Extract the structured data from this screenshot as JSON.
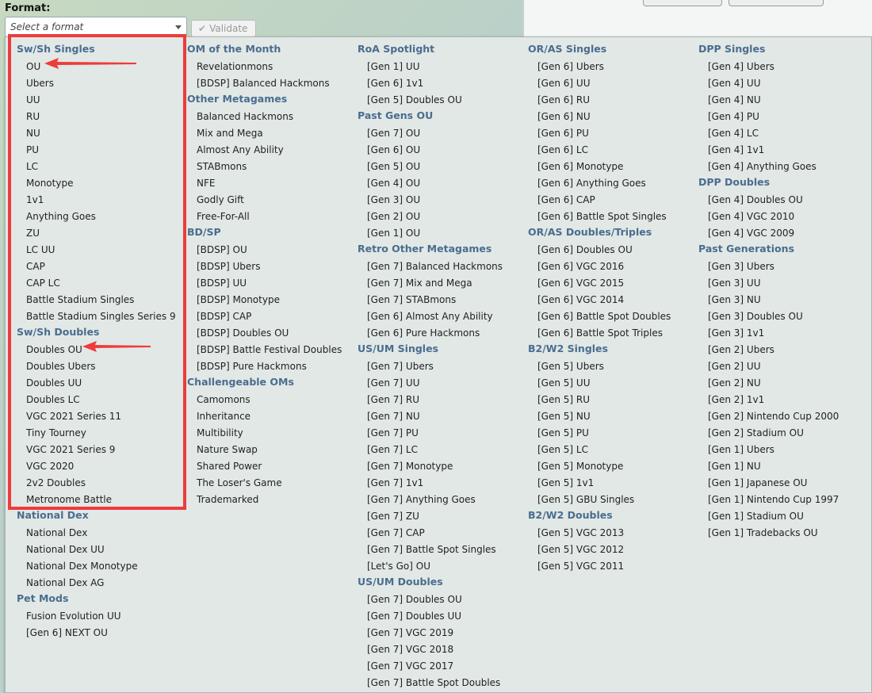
{
  "format_label": "Format:",
  "select_placeholder": "Select a format",
  "validate_label": "Validate",
  "columns": [
    {
      "sections": [
        {
          "title": "Sw/Sh Singles",
          "items": [
            "OU",
            "Ubers",
            "UU",
            "RU",
            "NU",
            "PU",
            "LC",
            "Monotype",
            "1v1",
            "Anything Goes",
            "ZU",
            "LC UU",
            "CAP",
            "CAP LC",
            "Battle Stadium Singles",
            "Battle Stadium Singles Series 9"
          ]
        },
        {
          "title": "Sw/Sh Doubles",
          "items": [
            "Doubles OU",
            "Doubles Ubers",
            "Doubles UU",
            "Doubles LC",
            "VGC 2021 Series 11",
            "Tiny Tourney",
            "VGC 2021 Series 9",
            "VGC 2020",
            "2v2 Doubles",
            "Metronome Battle"
          ]
        },
        {
          "title": "National Dex",
          "items": [
            "National Dex",
            "National Dex UU",
            "National Dex Monotype",
            "National Dex AG"
          ]
        },
        {
          "title": "Pet Mods",
          "items": [
            "Fusion Evolution UU",
            "[Gen 6] NEXT OU"
          ]
        }
      ]
    },
    {
      "sections": [
        {
          "title": "OM of the Month",
          "items": [
            "Revelationmons",
            "[BDSP] Balanced Hackmons"
          ]
        },
        {
          "title": "Other Metagames",
          "items": [
            "Balanced Hackmons",
            "Mix and Mega",
            "Almost Any Ability",
            "STABmons",
            "NFE",
            "Godly Gift",
            "Free-For-All"
          ]
        },
        {
          "title": "BD/SP",
          "items": [
            "[BDSP] OU",
            "[BDSP] Ubers",
            "[BDSP] UU",
            "[BDSP] Monotype",
            "[BDSP] CAP",
            "[BDSP] Doubles OU",
            "[BDSP] Battle Festival Doubles",
            "[BDSP] Pure Hackmons"
          ]
        },
        {
          "title": "Challengeable OMs",
          "items": [
            "Camomons",
            "Inheritance",
            "Multibility",
            "Nature Swap",
            "Shared Power",
            "The Loser's Game",
            "Trademarked"
          ]
        }
      ]
    },
    {
      "sections": [
        {
          "title": "RoA Spotlight",
          "items": [
            "[Gen 1] UU",
            "[Gen 6] 1v1",
            "[Gen 5] Doubles OU"
          ]
        },
        {
          "title": "Past Gens OU",
          "items": [
            "[Gen 7] OU",
            "[Gen 6] OU",
            "[Gen 5] OU",
            "[Gen 4] OU",
            "[Gen 3] OU",
            "[Gen 2] OU",
            "[Gen 1] OU"
          ]
        },
        {
          "title": "Retro Other Metagames",
          "items": [
            "[Gen 7] Balanced Hackmons",
            "[Gen 7] Mix and Mega",
            "[Gen 7] STABmons",
            "[Gen 6] Almost Any Ability",
            "[Gen 6] Pure Hackmons"
          ]
        },
        {
          "title": "US/UM Singles",
          "items": [
            "[Gen 7] Ubers",
            "[Gen 7] UU",
            "[Gen 7] RU",
            "[Gen 7] NU",
            "[Gen 7] PU",
            "[Gen 7] LC",
            "[Gen 7] Monotype",
            "[Gen 7] 1v1",
            "[Gen 7] Anything Goes",
            "[Gen 7] ZU",
            "[Gen 7] CAP",
            "[Gen 7] Battle Spot Singles",
            "[Let's Go] OU"
          ]
        },
        {
          "title": "US/UM Doubles",
          "items": [
            "[Gen 7] Doubles OU",
            "[Gen 7] Doubles UU",
            "[Gen 7] VGC 2019",
            "[Gen 7] VGC 2018",
            "[Gen 7] VGC 2017",
            "[Gen 7] Battle Spot Doubles"
          ]
        }
      ]
    },
    {
      "sections": [
        {
          "title": "OR/AS Singles",
          "items": [
            "[Gen 6] Ubers",
            "[Gen 6] UU",
            "[Gen 6] RU",
            "[Gen 6] NU",
            "[Gen 6] PU",
            "[Gen 6] LC",
            "[Gen 6] Monotype",
            "[Gen 6] Anything Goes",
            "[Gen 6] CAP",
            "[Gen 6] Battle Spot Singles"
          ]
        },
        {
          "title": "OR/AS Doubles/Triples",
          "items": [
            "[Gen 6] Doubles OU",
            "[Gen 6] VGC 2016",
            "[Gen 6] VGC 2015",
            "[Gen 6] VGC 2014",
            "[Gen 6] Battle Spot Doubles",
            "[Gen 6] Battle Spot Triples"
          ]
        },
        {
          "title": "B2/W2 Singles",
          "items": [
            "[Gen 5] Ubers",
            "[Gen 5] UU",
            "[Gen 5] RU",
            "[Gen 5] NU",
            "[Gen 5] PU",
            "[Gen 5] LC",
            "[Gen 5] Monotype",
            "[Gen 5] 1v1",
            "[Gen 5] GBU Singles"
          ]
        },
        {
          "title": "B2/W2 Doubles",
          "items": [
            "[Gen 5] VGC 2013",
            "[Gen 5] VGC 2012",
            "[Gen 5] VGC 2011"
          ]
        }
      ]
    },
    {
      "sections": [
        {
          "title": "DPP Singles",
          "items": [
            "[Gen 4] Ubers",
            "[Gen 4] UU",
            "[Gen 4] NU",
            "[Gen 4] PU",
            "[Gen 4] LC",
            "[Gen 4] 1v1",
            "[Gen 4] Anything Goes"
          ]
        },
        {
          "title": "DPP Doubles",
          "items": [
            "[Gen 4] Doubles OU",
            "[Gen 4] VGC 2010",
            "[Gen 4] VGC 2009"
          ]
        },
        {
          "title": "Past Generations",
          "items": [
            "[Gen 3] Ubers",
            "[Gen 3] UU",
            "[Gen 3] NU",
            "[Gen 3] Doubles OU",
            "[Gen 3] 1v1",
            "[Gen 2] Ubers",
            "[Gen 2] UU",
            "[Gen 2] NU",
            "[Gen 2] 1v1",
            "[Gen 2] Nintendo Cup 2000",
            "[Gen 2] Stadium OU",
            "[Gen 1] Ubers",
            "[Gen 1] NU",
            "[Gen 1] Japanese OU",
            "[Gen 1] Nintendo Cup 1997",
            "[Gen 1] Stadium OU",
            "[Gen 1] Tradebacks OU"
          ]
        }
      ]
    }
  ],
  "colors": {
    "section_title": "#4a6d8f",
    "highlight": "#ee3b3b",
    "panel_bg": "#e1e8e6"
  }
}
